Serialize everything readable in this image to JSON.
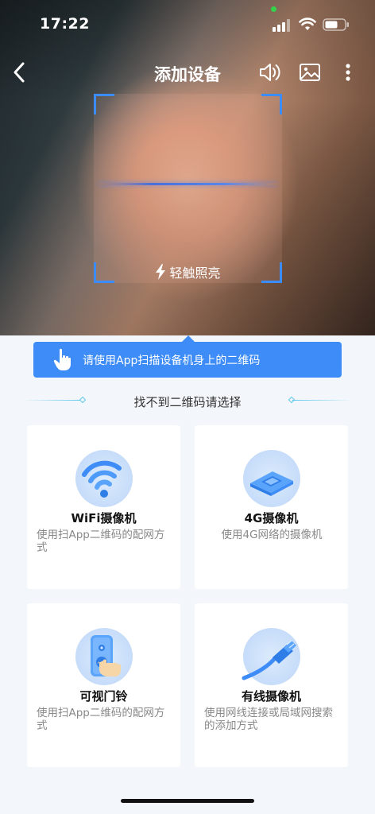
{
  "status_bar": {
    "time": "17:22"
  },
  "nav": {
    "title": "添加设备"
  },
  "scanner": {
    "flash_label": "轻触照亮"
  },
  "tip": {
    "text": "请使用App扫描设备机身上的二维码"
  },
  "divider": {
    "text": "找不到二维码请选择"
  },
  "options": [
    {
      "title": "WiFi摄像机",
      "desc": "使用扫App二维码的配网方式",
      "icon": "wifi-camera-icon"
    },
    {
      "title": "4G摄像机",
      "desc": "使用4G网络的摄像机",
      "icon": "sim-card-icon"
    },
    {
      "title": "可视门铃",
      "desc": "使用扫App二维码的配网方式",
      "icon": "doorbell-icon"
    },
    {
      "title": "有线摄像机",
      "desc": "使用网线连接或局域网搜索的添加方式",
      "icon": "ethernet-cable-icon"
    }
  ],
  "colors": {
    "accent": "#3d8cf7",
    "scan_corner": "#3a8cff",
    "background": "#f3f6fa"
  }
}
